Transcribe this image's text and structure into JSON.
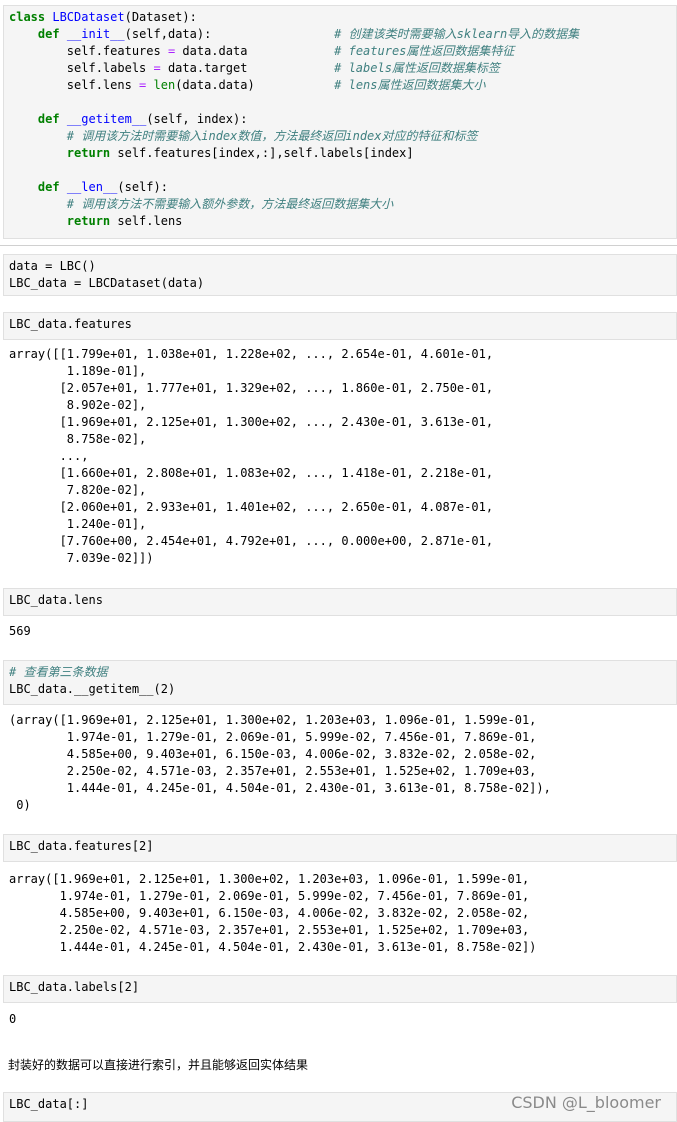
{
  "cell1": {
    "lines": [
      "class LBCDataset(Dataset):",
      "    def __init__(self,data):                 # 创建该类时需要输入sklearn导入的数据集",
      "        self.features = data.data            # features属性返回数据集特征",
      "        self.labels = data.target            # labels属性返回数据集标签",
      "        self.lens = len(data.data)           # lens属性返回数据集大小",
      "",
      "    def __getitem__(self, index):",
      "        # 调用该方法时需要输入index数值，方法最终返回index对应的特征和标签",
      "        return self.features[index,:],self.labels[index]",
      "",
      "    def __len__(self):",
      "        # 调用该方法不需要输入额外参数，方法最终返回数据集大小",
      "        return self.lens"
    ]
  },
  "cell2": {
    "code": "data = LBC()\nLBC_data = LBCDataset(data)"
  },
  "cell3": {
    "code": "LBC_data.features",
    "output": "array([[1.799e+01, 1.038e+01, 1.228e+02, ..., 2.654e-01, 4.601e-01,\n        1.189e-01],\n       [2.057e+01, 1.777e+01, 1.329e+02, ..., 1.860e-01, 2.750e-01,\n        8.902e-02],\n       [1.969e+01, 2.125e+01, 1.300e+02, ..., 2.430e-01, 3.613e-01,\n        8.758e-02],\n       ...,\n       [1.660e+01, 2.808e+01, 1.083e+02, ..., 1.418e-01, 2.218e-01,\n        7.820e-02],\n       [2.060e+01, 2.933e+01, 1.401e+02, ..., 2.650e-01, 4.087e-01,\n        1.240e-01],\n       [7.760e+00, 2.454e+01, 4.792e+01, ..., 0.000e+00, 2.871e-01,\n        7.039e-02]])"
  },
  "cell4": {
    "code": "LBC_data.lens",
    "output": "569"
  },
  "cell5": {
    "comment": "# 查看第三条数据",
    "code": "LBC_data.__getitem__(2)",
    "output": "(array([1.969e+01, 2.125e+01, 1.300e+02, 1.203e+03, 1.096e-01, 1.599e-01,\n        1.974e-01, 1.279e-01, 2.069e-01, 5.999e-02, 7.456e-01, 7.869e-01,\n        4.585e+00, 9.403e+01, 6.150e-03, 4.006e-02, 3.832e-02, 2.058e-02,\n        2.250e-02, 4.571e-03, 2.357e+01, 2.553e+01, 1.525e+02, 1.709e+03,\n        1.444e-01, 4.245e-01, 4.504e-01, 2.430e-01, 3.613e-01, 8.758e-02]),\n 0)"
  },
  "cell6": {
    "code": "LBC_data.features[2]",
    "output": "array([1.969e+01, 2.125e+01, 1.300e+02, 1.203e+03, 1.096e-01, 1.599e-01,\n       1.974e-01, 1.279e-01, 2.069e-01, 5.999e-02, 7.456e-01, 7.869e-01,\n       4.585e+00, 9.403e+01, 6.150e-03, 4.006e-02, 3.832e-02, 2.058e-02,\n       2.250e-02, 4.571e-03, 2.357e+01, 2.553e+01, 1.525e+02, 1.709e+03,\n       1.444e-01, 4.245e-01, 4.504e-01, 2.430e-01, 3.613e-01, 8.758e-02])"
  },
  "cell7": {
    "code": "LBC_data.labels[2]",
    "output": "0"
  },
  "prose": "封装好的数据可以直接进行索引，并且能够返回实体结果",
  "cell8": {
    "code": "LBC_data[:]"
  },
  "watermark": "CSDN @L_bloomer"
}
